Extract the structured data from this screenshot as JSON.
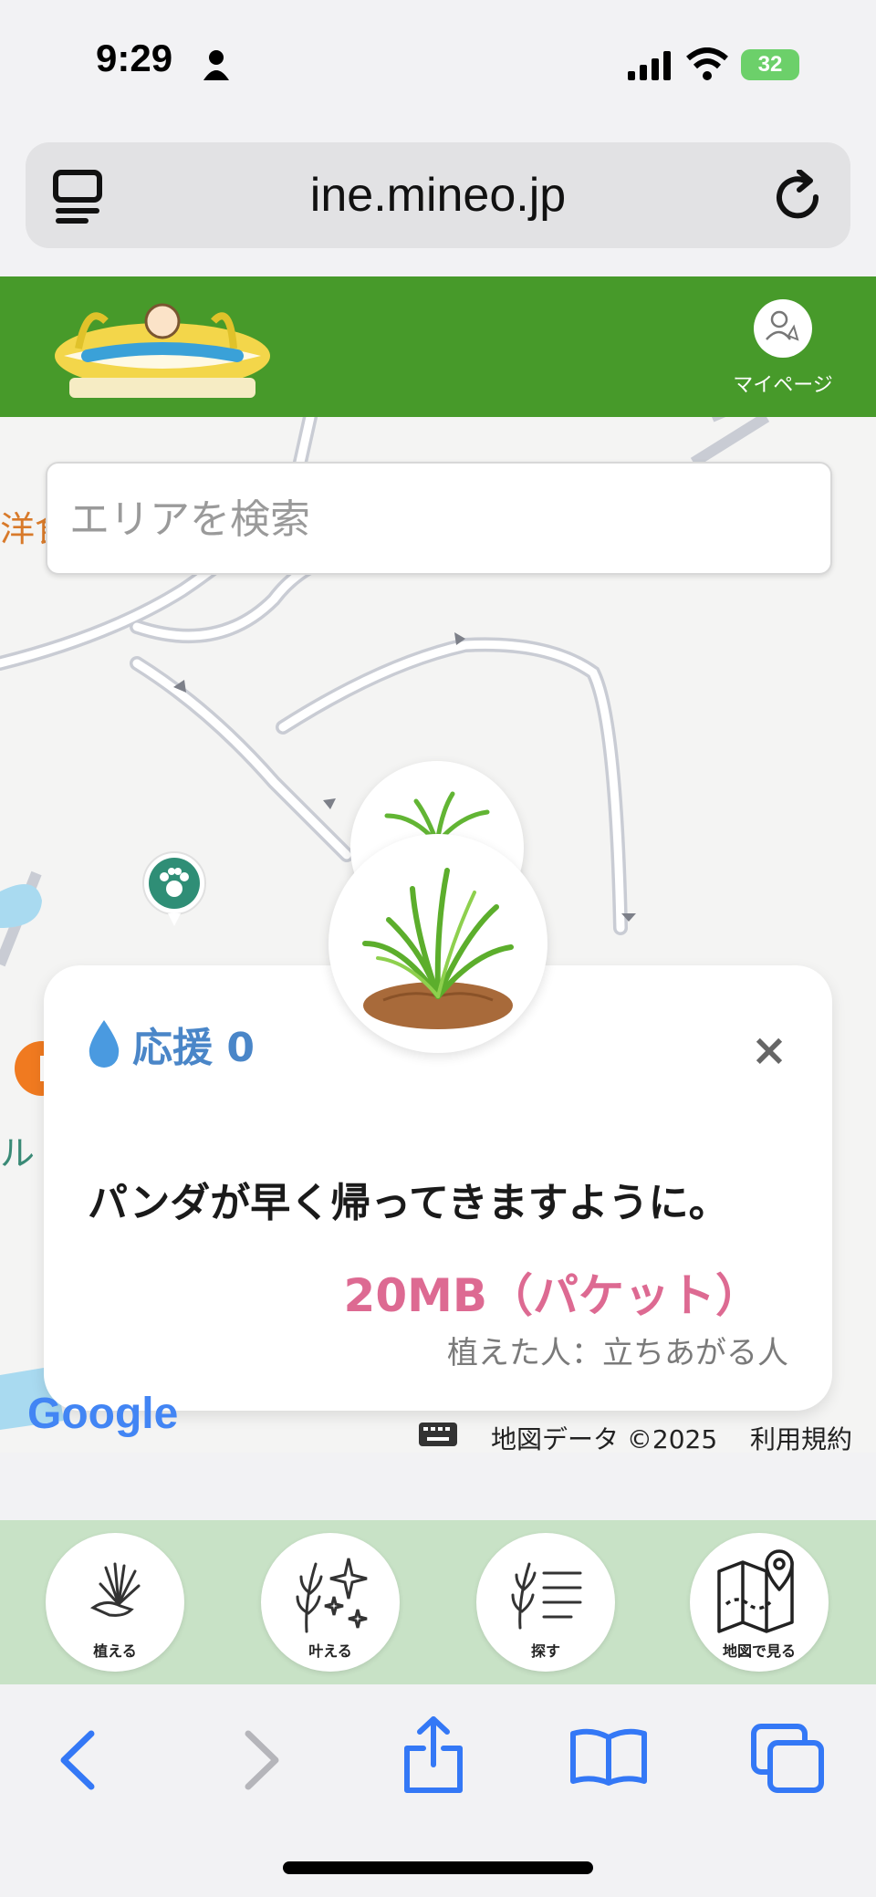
{
  "status_bar": {
    "time": "9:29",
    "battery": "32"
  },
  "browser": {
    "url": "ine.mineo.jp"
  },
  "header": {
    "logo_name": "ネガイナホ logo",
    "mypage_label": "マイページ"
  },
  "search": {
    "placeholder": "エリアを検索"
  },
  "map": {
    "partial_labels": [
      "洋食",
      "ル"
    ],
    "credit": "地図データ ©2025",
    "terms": "利用規約",
    "google_logo": "Google"
  },
  "popup": {
    "cheer_label": "応援 0",
    "close_label": "×",
    "wish": "パンダが早く帰ってきますように。",
    "reward": "20MB（パケット）",
    "planter": "植えた人：立ちあがる人"
  },
  "bottom_nav": [
    {
      "label": "植える",
      "icon": "plant-hand-icon"
    },
    {
      "label": "叶える",
      "icon": "sparkle-wheat-icon"
    },
    {
      "label": "探す",
      "icon": "search-list-icon"
    },
    {
      "label": "地図で見る",
      "icon": "map-pin-icon"
    }
  ],
  "colors": {
    "header": "#479a2a",
    "nav_bg": "#c8e2c6",
    "accent_blue": "#4a86c8",
    "reward_pink": "#dd6a92",
    "ios_blue": "#3478f6"
  }
}
